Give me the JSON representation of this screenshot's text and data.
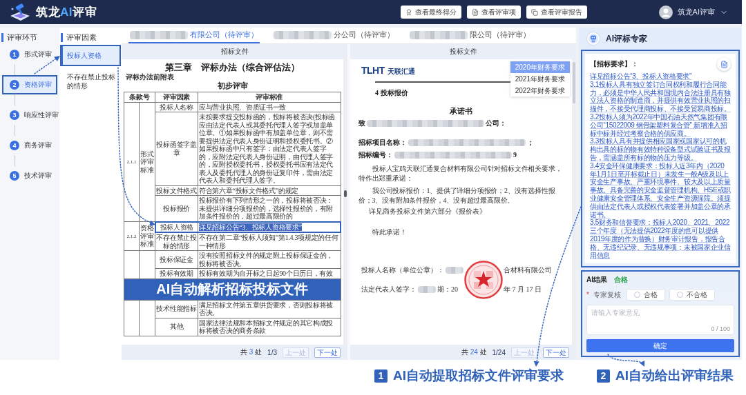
{
  "header": {
    "brand": [
      {
        "text": "筑龙",
        "accent": false
      },
      {
        "text": "AI",
        "accent": true
      },
      {
        "text": "评审",
        "accent": false
      }
    ],
    "actions": [
      "查看最终得分",
      "查看评审项",
      "查看评审报告"
    ],
    "user": {
      "name": "筑龙AI评审"
    }
  },
  "stages": {
    "title": "评审环节",
    "items": [
      {
        "number": "1",
        "label": "形式评审",
        "selected": false
      },
      {
        "number": "2",
        "label": "资格评审",
        "selected": true
      },
      {
        "number": "3",
        "label": "响应性评审",
        "selected": false
      },
      {
        "number": "4",
        "label": "商务评审",
        "selected": false
      },
      {
        "number": "5",
        "label": "技术评审",
        "selected": false
      }
    ]
  },
  "factors": {
    "title": "评审因素",
    "items": [
      {
        "label": "投标人资格",
        "selected": true
      },
      {
        "label": "不存在禁止投标的情形",
        "selected": false
      }
    ]
  },
  "bidder_tabs": [
    {
      "label": "有限公司（待评审）",
      "redacted": true,
      "selected": true
    },
    {
      "label": "分公司（待评审）",
      "redacted": true,
      "selected": false
    },
    {
      "label": "限公司（待评审）",
      "redacted": true,
      "selected": false
    }
  ],
  "tender_document": {
    "heading": "招标文件",
    "title": "第三章　评标办法（综合评估法）",
    "caption": "评标办法前附表",
    "subtitle": "初步评审",
    "columns": [
      "条款号",
      "评审因素",
      "评审标准"
    ],
    "groups": [
      {
        "clause": "2.1.1",
        "category": "形式评审标准",
        "rows": [
          {
            "kind": "row",
            "factor": "投标人名称",
            "standard": "应与营业执照、资质证书一致",
            "highlighted": false
          },
          {
            "kind": "row",
            "factor": "投标函签字盖章",
            "standard": "未按要求提交投标函的，投标将被否决(投标函应由法定代表人或其委托代理人签字或加盖单位章。①如果投标函中有加盖单位章，则不需要提供法定代表人身份证明和授权委托书。②如果投标函中只有签字：由法定代表人签字的，应附法定代表人身份证明，由代理人签字的，应附授权委托书，授权委托书应有法定代表人及委托代理人的身份证复印件，需由法定代表人和委托代理人签字。",
            "highlighted": false
          },
          {
            "kind": "row",
            "factor": "投标文件格式",
            "standard": "符合第六章“投标文件格式”的规定",
            "highlighted": false
          },
          {
            "kind": "row",
            "factor": "投标报价",
            "standard": "投标报价有下列情形之一的，投标将被否决：未提供详细分项报价的，选择性报价的，有附加条件报价的，超过最高限价的",
            "highlighted": false
          }
        ]
      },
      {
        "clause": "2.1.2",
        "category": "资格评审标准",
        "rows": [
          {
            "kind": "row",
            "factor": "投标人资格",
            "standard": "详见招标公告“3、投标人资格要求”",
            "highlighted": true
          },
          {
            "kind": "row",
            "factor": "不存在禁止投标的情形",
            "standard": "不存在第二章“投标人须知”第1.4.3项规定的任何一种情形",
            "highlighted": false
          }
        ]
      },
      {
        "rows": [
          {
            "kind": "row",
            "factor": "投标保证金",
            "standard": "没有按照招标文件的规定附上投标保证金的，投标将被否决。",
            "highlighted": false
          },
          {
            "kind": "row",
            "factor": "投标有效期",
            "standard": "投标有效期为自开标之日起90个日历日，有效",
            "highlighted": false
          },
          {
            "kind": "banner",
            "text": "AI自动解析招标投标文件"
          },
          {
            "kind": "row",
            "factor": "技术性能指标",
            "standard": "满足招标文件第五章供货要求，否则投标将被否决。",
            "highlighted": false
          },
          {
            "kind": "row",
            "factor": "其他",
            "standard": "国家法律法规和本招标文件规定的其它构成投标将被否决的商务条款",
            "highlighted": false
          }
        ]
      }
    ],
    "matches": {
      "prefix": "共",
      "count": "3",
      "suffix": "处"
    },
    "page": "1/3",
    "prev": {
      "label": "上一处",
      "disabled": true
    },
    "next": {
      "label": "下一处",
      "disabled": false
    }
  },
  "bid_document": {
    "heading": "投标文件",
    "logo": {
      "mark": "TLHT",
      "name": "天联汇通"
    },
    "section": "4 投标报价",
    "title": "承诺书",
    "blocks": [
      {
        "kind": "addressee",
        "segments": [
          {
            "kind": "text",
            "text": "致"
          },
          {
            "kind": "redacted"
          },
          {
            "kind": "text",
            "text": "公司："
          }
        ]
      },
      {
        "kind": "field",
        "segments": [
          {
            "kind": "text",
            "text": "招标项目名称："
          },
          {
            "kind": "redacted"
          },
          {
            "kind": "text",
            "text": "；"
          }
        ]
      },
      {
        "kind": "field",
        "segments": [
          {
            "kind": "text",
            "text": "招标编号："
          },
          {
            "kind": "redacted"
          },
          {
            "kind": "text",
            "text": "9"
          }
        ]
      },
      {
        "kind": "paragraph",
        "text": "投标人宝鸡天联汇通复合材料有限公司针对招标文件相关要求，特作出郑重承诺："
      },
      {
        "kind": "paragraph",
        "text": "我公司投标报价：1、提供了详细分项报价；2、没有选择性报价；3、没有附加条件报价，4、没有超过最高限价。"
      },
      {
        "kind": "note",
        "text": "详见商务投标文件第六部分《报价表》"
      },
      {
        "kind": "closing",
        "text": "特此承诺！"
      },
      {
        "kind": "signature",
        "seal": true,
        "rows": [
          {
            "segments": [
              {
                "kind": "text",
                "text": "投标人名称（单位公章）："
              },
              {
                "kind": "redacted"
              }
            ],
            "tail": "合材料有限公司"
          },
          {
            "segments": [
              {
                "kind": "text",
                "text": "法定代表人签字："
              },
              {
                "kind": "redacted"
              },
              {
                "kind": "text",
                "text": "期：20"
              }
            ],
            "tail": "年 7 月 17 日"
          }
        ]
      }
    ],
    "menu": [
      {
        "label": "2020年财务要求",
        "selected": true
      },
      {
        "label": "2021年财务要求",
        "selected": false
      },
      {
        "label": "2022年财务要求",
        "selected": false
      }
    ],
    "matches": {
      "prefix": "共",
      "count": "24",
      "suffix": "处"
    },
    "page": "1/24",
    "prev": {
      "label": "上一处",
      "disabled": true
    },
    "next": {
      "label": "下一处",
      "disabled": false
    }
  },
  "ai_panel": {
    "title": "AI评标专家",
    "requirements": {
      "heading": "【招标要求】：",
      "paragraphs": [
        "详见招标公告“3、投标人资格要求”",
        "3.1投标人具有独立签订合同权利和履行合同能力，必须是中华人民共和国境内合法注册具有独立法人资格的制造商，并提供有效营业执照的扫描件，不接受代理商投标、不接受贸易商投标。",
        "3.2投标人须为2022年中国石油天然气集团有限公司“15022009 钢骨架塑料复合管” 新增准入招标中标并经过考察合格的供应商。",
        "3.3投标人具有并提供相应国家或国家认可的机构出具的标的物有效特种设备型式试验证书及报告，需涵盖所有标的物的压力等级。",
        "3.4安全环保健康要求：投标人近3年内（2020年1月1日至开标截止日）未发生一般A级及以上安全生产事故、严重环境事件、较大及以上质量事故。具备完善的安全监督管理机构、HSE或职业健康安全管理体系、安全生产资源保障。须提供由法定代表人或授权代表签署并加盖公章的承诺书。",
        "3.5财务和信誉要求：投标人2020、2021、2022三个年度（无法提供2022年度的也可以提供2019年度的作为替换）财务审计报告，报告合格、无违纪记录、无违规事项；未被国家企业信用信息"
      ]
    },
    "result": {
      "label": "AI结果",
      "verdict": "合格",
      "review": {
        "required_mark": "*",
        "label": "专家复核",
        "options": [
          {
            "label": "合格",
            "selected": false
          },
          {
            "label": "不合格",
            "selected": false
          }
        ]
      },
      "comment": {
        "placeholder": "请输入专家意见",
        "counter": "0 / 100"
      },
      "submit": "确定"
    }
  },
  "callouts": [
    {
      "number": "1",
      "text": "AI自动提取招标文件评审要求"
    },
    {
      "number": "2",
      "text": "AI自动给出评审结果"
    }
  ]
}
